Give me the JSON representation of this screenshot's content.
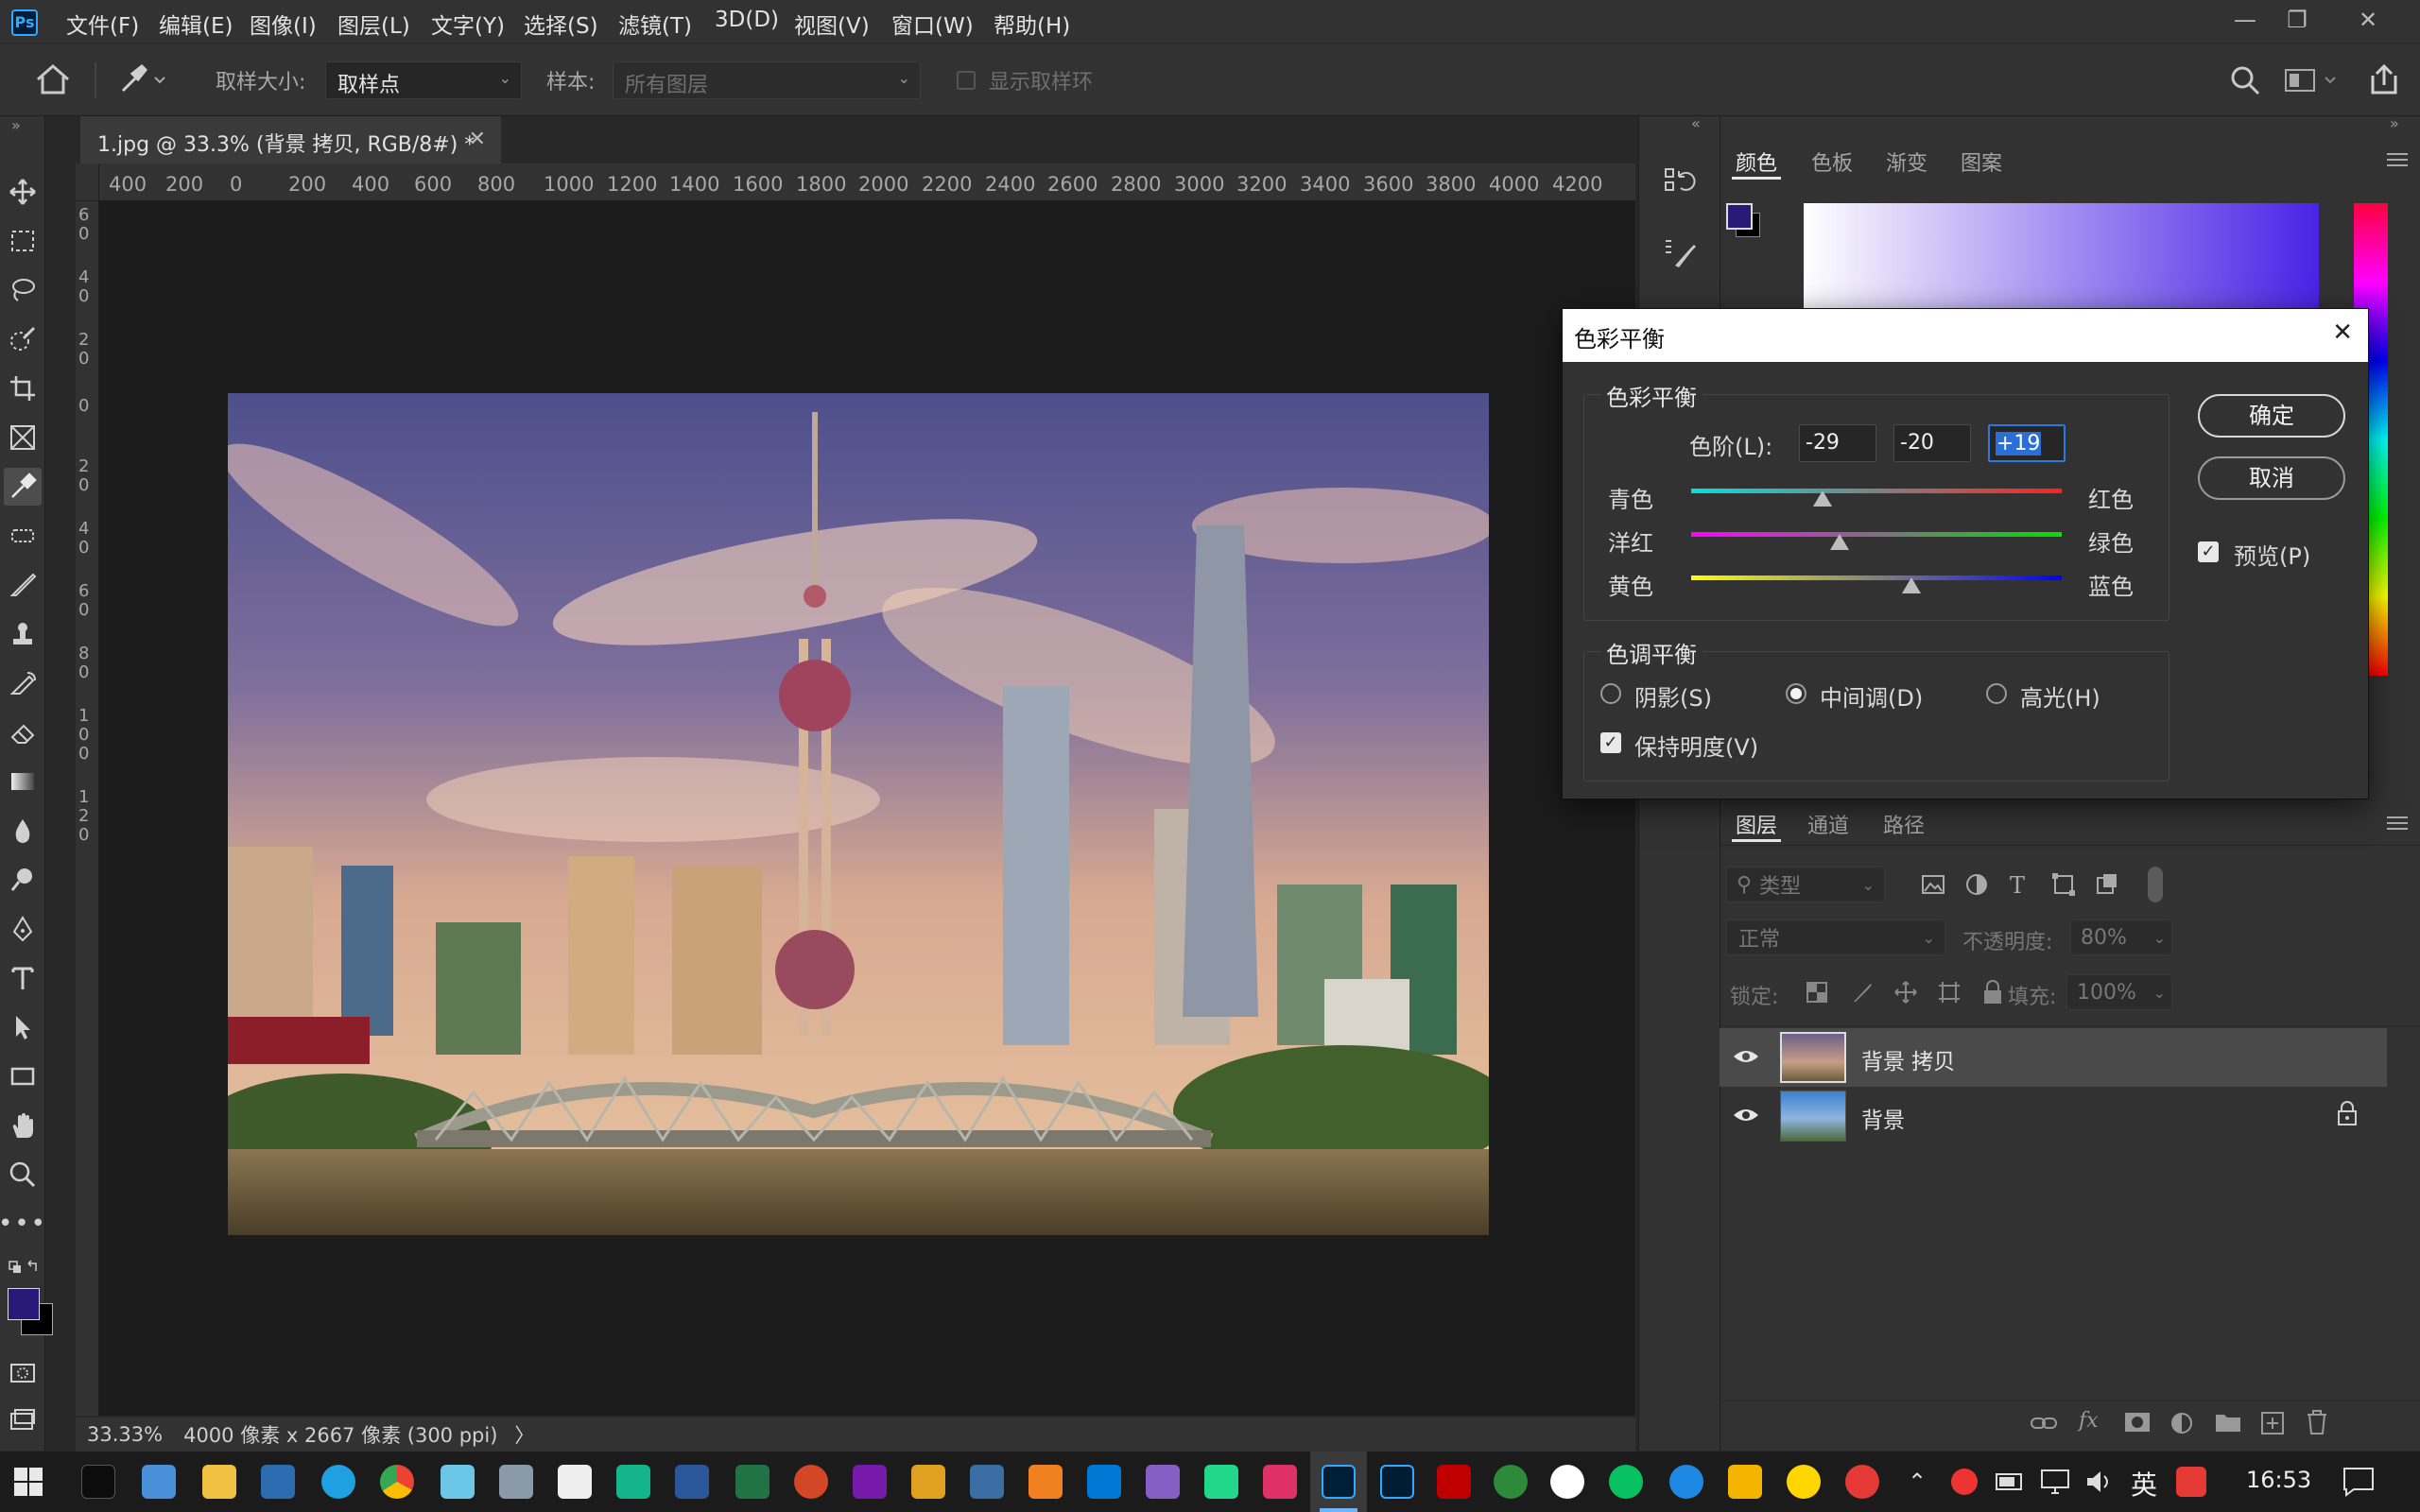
{
  "menu": {
    "logo": "Ps",
    "items": [
      "文件(F)",
      "编辑(E)",
      "图像(I)",
      "图层(L)",
      "文字(Y)",
      "选择(S)",
      "滤镜(T)",
      "3D(D)",
      "视图(V)",
      "窗口(W)",
      "帮助(H)"
    ]
  },
  "options": {
    "sample_size_label": "取样大小:",
    "sample_size_value": "取样点",
    "sample_label": "样本:",
    "sample_value": "所有图层",
    "show_ring_label": "显示取样环"
  },
  "document": {
    "tab_title": "1.jpg @ 33.3% (背景 拷贝, RGB/8#) *",
    "ruler_h": [
      "400",
      "200",
      "0",
      "200",
      "400",
      "600",
      "800",
      "1000",
      "1200",
      "1400",
      "1600",
      "1800",
      "2000",
      "2200",
      "2400",
      "2600",
      "2800",
      "3000",
      "3200",
      "3400",
      "3600",
      "3800",
      "4000",
      "4200"
    ],
    "ruler_v": [
      "6",
      "0",
      "4",
      "0",
      "2",
      "0",
      "0",
      "2",
      "0",
      "4",
      "0",
      "6",
      "0",
      "8",
      "0",
      "1",
      "0",
      "0",
      "1",
      "2",
      "0"
    ]
  },
  "status": {
    "zoom": "33.33%",
    "dimensions": "4000 像素 x 2667 像素 (300 ppi)",
    "arrow": "〉"
  },
  "color_panel": {
    "tabs": [
      "颜色",
      "色板",
      "渐变",
      "图案"
    ],
    "foreground": "#2a1a78",
    "background": "#000000"
  },
  "dialog": {
    "title": "色彩平衡",
    "group_balance": "色彩平衡",
    "levels_label": "色阶(L):",
    "levels": [
      "-29",
      "-20",
      "+19"
    ],
    "sliders": [
      {
        "left": "青色",
        "right": "红色",
        "value": -29
      },
      {
        "left": "洋红",
        "right": "绿色",
        "value": -20
      },
      {
        "left": "黄色",
        "right": "蓝色",
        "value": 19
      }
    ],
    "group_tone": "色调平衡",
    "tones": [
      "阴影(S)",
      "中间调(D)",
      "高光(H)"
    ],
    "tone_selected": 1,
    "preserve_label": "保持明度(V)",
    "ok": "确定",
    "cancel": "取消",
    "preview_label": "预览(P)"
  },
  "layers_panel": {
    "tabs": [
      "图层",
      "通道",
      "路径"
    ],
    "filter_label": "类型",
    "blend_mode": "正常",
    "opacity_label": "不透明度:",
    "opacity_value": "80%",
    "lock_label": "锁定:",
    "fill_label": "填充:",
    "fill_value": "100%",
    "layers": [
      {
        "name": "背景 拷贝",
        "selected": true
      },
      {
        "name": "背景",
        "selected": false
      }
    ]
  },
  "taskbar": {
    "lang": "英",
    "time": "16:53"
  }
}
